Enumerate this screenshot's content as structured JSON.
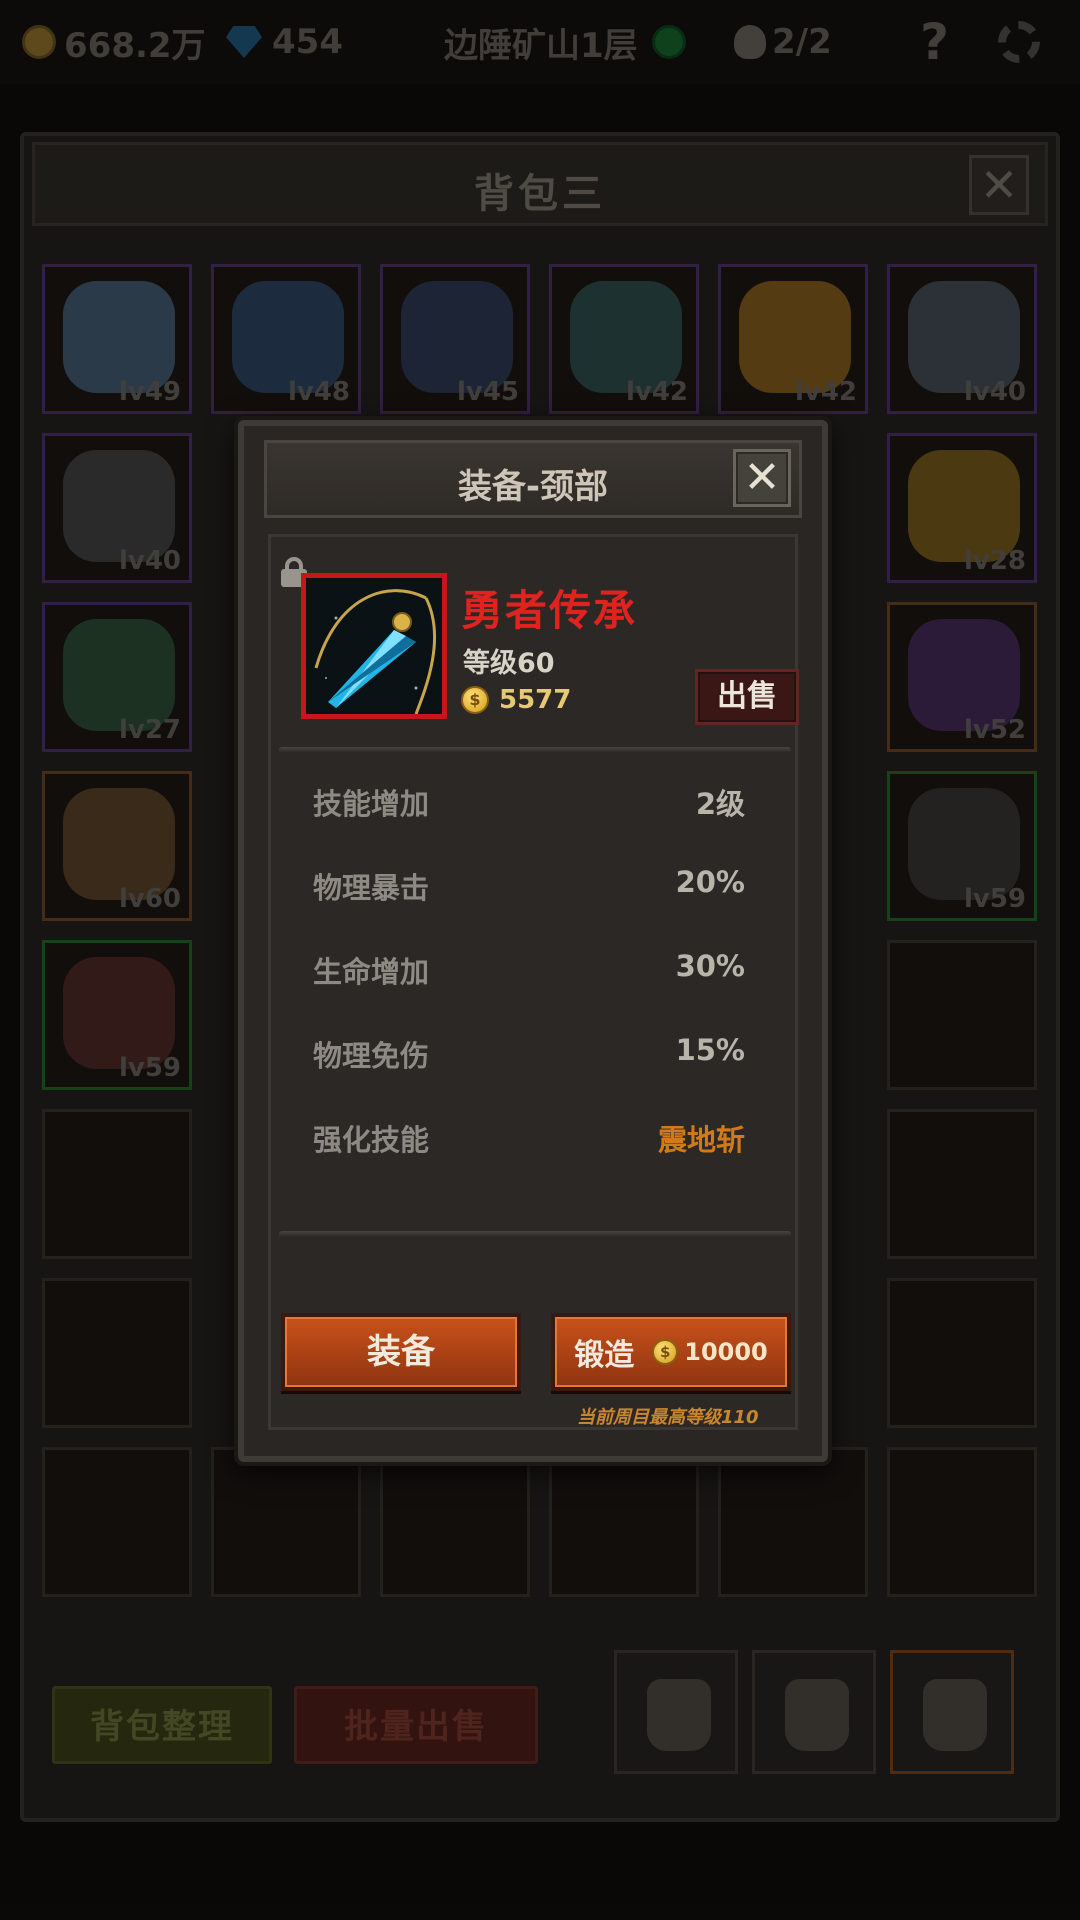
{
  "topbar": {
    "gold": "668.2万",
    "gems": "454",
    "location": "边陲矿山1层",
    "skull_count": "2/2",
    "help_glyph": "?"
  },
  "backpack": {
    "title": "背包三",
    "close_glyph": "✕",
    "slots": [
      {
        "level": "lv49",
        "rarity": "purple",
        "icon": "axe-icon",
        "color": "#4a6e8a"
      },
      {
        "level": "lv48",
        "rarity": "purple",
        "icon": "shield-icon",
        "color": "#2b4f78"
      },
      {
        "level": "lv45",
        "rarity": "purple",
        "icon": "armor-icon",
        "color": "#2c3e66"
      },
      {
        "level": "lv42",
        "rarity": "purple",
        "icon": "orb-icon",
        "color": "#2a5a5a"
      },
      {
        "level": "lv42",
        "rarity": "purple",
        "icon": "ring-icon",
        "color": "#a0701a"
      },
      {
        "level": "lv40",
        "rarity": "purple",
        "icon": "axe-icon",
        "color": "#4a5a66"
      },
      {
        "level": "lv40",
        "rarity": "purple",
        "icon": "helmet-icon",
        "color": "#4a4a50"
      },
      {
        "level": "lv28",
        "rarity": "purple",
        "icon": "amulet-icon",
        "color": "#8a6a1a"
      },
      {
        "level": "lv27",
        "rarity": "purple",
        "icon": "ring-icon",
        "color": "#2a5a3a"
      },
      {
        "level": "lv52",
        "rarity": "orange",
        "icon": "amulet-icon",
        "color": "#4a2a6a"
      },
      {
        "level": "lv60",
        "rarity": "orange",
        "icon": "bracer-icon",
        "color": "#6a4a2a"
      },
      {
        "level": "lv59",
        "rarity": "green",
        "icon": "ring-icon",
        "color": "#3a3a3a"
      },
      {
        "level": "lv59",
        "rarity": "green",
        "icon": "helmet-icon",
        "color": "#5a2a2a"
      }
    ],
    "sort_label": "背包整理",
    "bulk_sell_label": "批量出售"
  },
  "dialog": {
    "title": "装备-颈部",
    "close_glyph": "✕",
    "item": {
      "name": "勇者传承",
      "level": "等级60",
      "price": "5577",
      "coin_glyph": "$",
      "icon": "crystal-pendant-icon",
      "rarity_color": "#c4161c"
    },
    "sell_label": "出售",
    "stats": [
      {
        "label": "技能增加",
        "value": "2级"
      },
      {
        "label": "物理暴击",
        "value": "20%"
      },
      {
        "label": "生命增加",
        "value": "30%"
      },
      {
        "label": "物理免伤",
        "value": "15%"
      },
      {
        "label": "强化技能",
        "value": "震地斩"
      }
    ],
    "equip_label": "装备",
    "forge_label": "锻造",
    "forge_cost": "10000",
    "cycle_note": "当前周目最高等级110"
  }
}
